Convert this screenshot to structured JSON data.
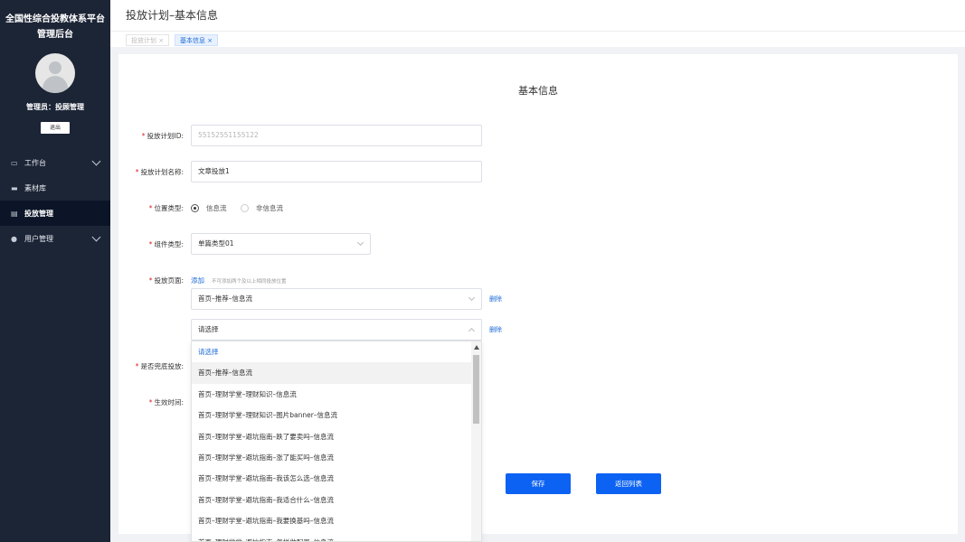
{
  "sidebar": {
    "brand_line1": "全国性综合投教体系平台",
    "brand_line2": "管理后台",
    "admin_label": "管理员：投顾管理",
    "logout_label": "退出",
    "items": [
      {
        "label": "工作台",
        "icon": "monitor-icon",
        "has_chevron": true
      },
      {
        "label": "素材库",
        "icon": "folder-icon",
        "has_chevron": false
      },
      {
        "label": "投放管理",
        "icon": "inbox-icon",
        "has_chevron": false,
        "active": true
      },
      {
        "label": "用户管理",
        "icon": "user-icon",
        "has_chevron": true
      }
    ]
  },
  "header": {
    "title": "投放计划–基本信息"
  },
  "tabs": [
    {
      "label": "投放计划",
      "close": "×",
      "active": false
    },
    {
      "label": "基本信息",
      "close": "×",
      "active": true
    }
  ],
  "form": {
    "title": "基本信息",
    "plan_id_label": "投放计划ID:",
    "plan_id_placeholder": "55152551155122",
    "plan_name_label": "投放计划名称:",
    "plan_name_value": "文章投放1",
    "position_type_label": "位置类型:",
    "position_options": [
      "信息流",
      "非信息流"
    ],
    "component_type_label": "组件类型:",
    "component_type_value": "单篇类型01",
    "page_label": "投放页面:",
    "add_label": "添加",
    "add_hint": "不可添加两个及以上相同投放位置",
    "page_select_1": "首页–推荐–信息流",
    "page_select_2": "请选择",
    "delete_label": "删除",
    "fallback_label": "是否兜底投放:",
    "effective_time_label": "生效时间:",
    "save_label": "保存",
    "back_label": "返回列表"
  },
  "dropdown": {
    "options": [
      "请选择",
      "首页–推荐–信息流",
      "首页–理财学堂–理财知识–信息流",
      "首页–理财学堂–理财知识–图片banner–信息流",
      "首页–理财学堂–避坑指南–跌了要卖吗–信息流",
      "首页–理财学堂–避坑指南–涨了能买吗–信息流",
      "首页–理财学堂–避坑指南–我该怎么选–信息流",
      "首页–理财学堂–避坑指南–我适合什么–信息流",
      "首页–理财学堂–避坑指南–我要换基吗–信息流",
      "首页–理财学堂–避坑指南–怎样做配置–信息流"
    ]
  },
  "colors": {
    "sidebar_bg": "#1c2536",
    "accent": "#0c62f2",
    "required": "#e02020"
  }
}
